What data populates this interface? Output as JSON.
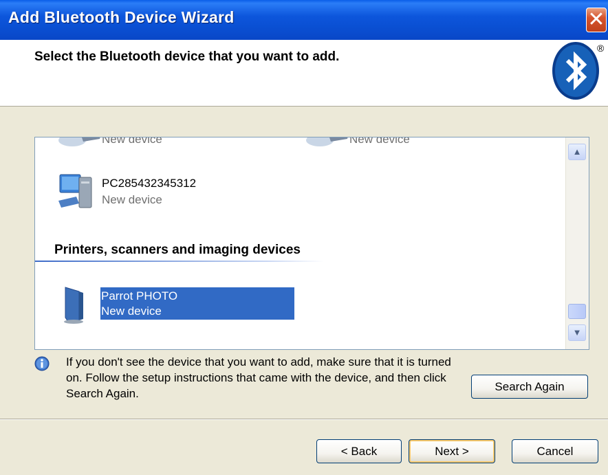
{
  "window": {
    "title": "Add Bluetooth Device Wizard"
  },
  "header": {
    "heading": "Select the Bluetooth device that you want to add.",
    "logo_registered": "®"
  },
  "devices_top": [
    {
      "name": "",
      "status": "New device"
    },
    {
      "name": "",
      "status": "New device"
    }
  ],
  "device_pc": {
    "name": "PC285432345312",
    "status": "New device"
  },
  "group": {
    "title": "Printers, scanners and imaging devices"
  },
  "device_printer": {
    "name": "Parrot PHOTO",
    "status": "New device"
  },
  "info": {
    "text": "If you don't see the device that you want to add, make sure that it is turned on. Follow the setup instructions that came with the device, and then click Search Again."
  },
  "buttons": {
    "search_again": "Search Again",
    "back": "< Back",
    "next": "Next >",
    "cancel": "Cancel"
  },
  "colors": {
    "title_bar": "#0a4fd2",
    "selection": "#316ac5",
    "dialog_bg": "#ece9d8"
  }
}
